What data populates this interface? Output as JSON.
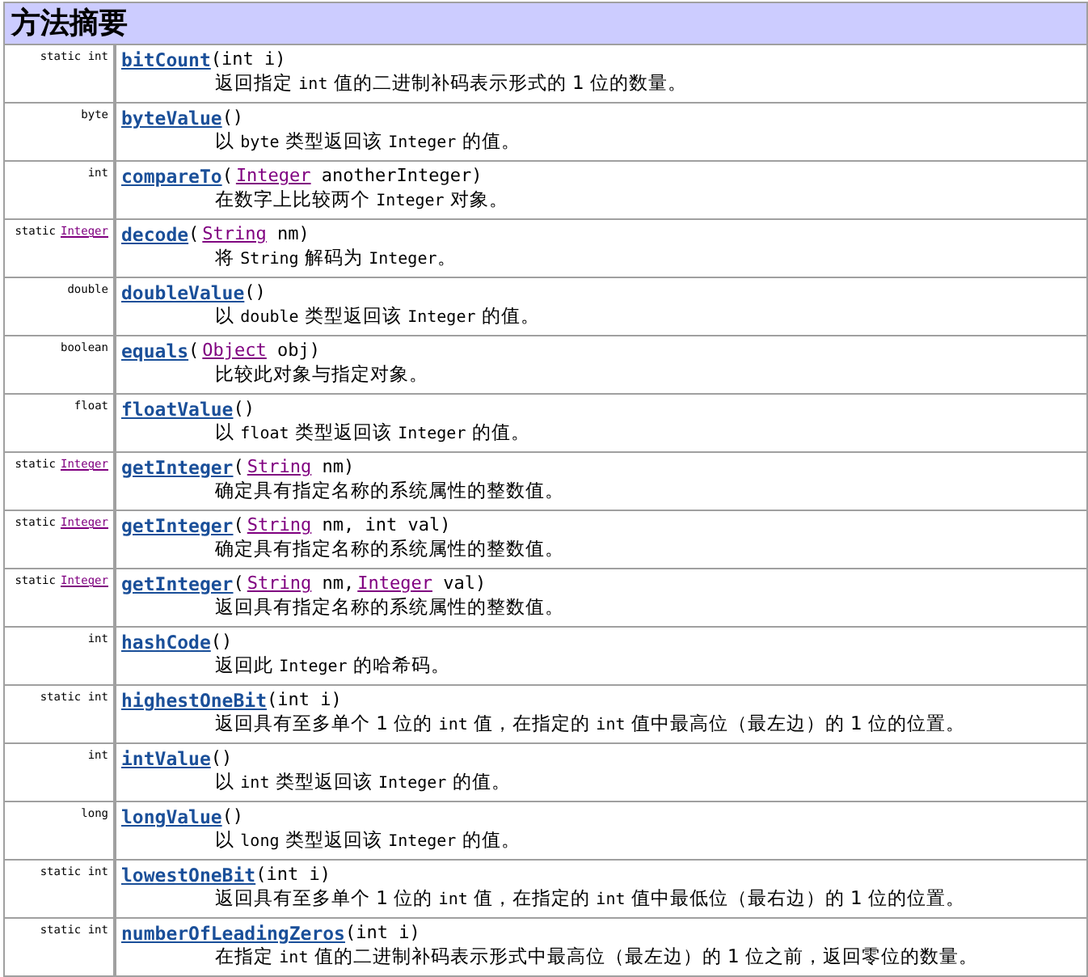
{
  "title": "方法摘要",
  "rows": [
    {
      "modifier": [
        {
          "kind": "text",
          "text": "static int"
        }
      ],
      "signature": [
        {
          "kind": "name",
          "text": "bitCount"
        },
        {
          "kind": "text",
          "text": "(int i)"
        }
      ],
      "description": [
        {
          "kind": "text",
          "text": "返回指定 "
        },
        {
          "kind": "code",
          "text": "int"
        },
        {
          "kind": "text",
          "text": " 值的二进制补码表示形式的 1 位的数量。"
        }
      ]
    },
    {
      "modifier": [
        {
          "kind": "text",
          "text": "byte"
        }
      ],
      "signature": [
        {
          "kind": "name",
          "text": "byteValue"
        },
        {
          "kind": "text",
          "text": "()"
        }
      ],
      "description": [
        {
          "kind": "text",
          "text": "以 "
        },
        {
          "kind": "code",
          "text": "byte"
        },
        {
          "kind": "text",
          "text": " 类型返回该 "
        },
        {
          "kind": "code",
          "text": "Integer"
        },
        {
          "kind": "text",
          "text": " 的值。"
        }
      ]
    },
    {
      "modifier": [
        {
          "kind": "text",
          "text": "int"
        }
      ],
      "signature": [
        {
          "kind": "name",
          "text": "compareTo"
        },
        {
          "kind": "text",
          "text": "("
        },
        {
          "kind": "type",
          "text": "Integer"
        },
        {
          "kind": "text",
          "text": " anotherInteger)"
        }
      ],
      "description": [
        {
          "kind": "text",
          "text": "在数字上比较两个 "
        },
        {
          "kind": "code",
          "text": "Integer"
        },
        {
          "kind": "text",
          "text": " 对象。"
        }
      ]
    },
    {
      "modifier": [
        {
          "kind": "text",
          "text": "static"
        },
        {
          "kind": "type",
          "text": "Integer"
        }
      ],
      "signature": [
        {
          "kind": "name",
          "text": "decode"
        },
        {
          "kind": "text",
          "text": "("
        },
        {
          "kind": "type",
          "text": "String"
        },
        {
          "kind": "text",
          "text": " nm)"
        }
      ],
      "description": [
        {
          "kind": "text",
          "text": "将 "
        },
        {
          "kind": "code",
          "text": "String"
        },
        {
          "kind": "text",
          "text": " 解码为 "
        },
        {
          "kind": "code",
          "text": "Integer"
        },
        {
          "kind": "text",
          "text": "。"
        }
      ]
    },
    {
      "modifier": [
        {
          "kind": "text",
          "text": "double"
        }
      ],
      "signature": [
        {
          "kind": "name",
          "text": "doubleValue"
        },
        {
          "kind": "text",
          "text": "()"
        }
      ],
      "description": [
        {
          "kind": "text",
          "text": "以 "
        },
        {
          "kind": "code",
          "text": "double"
        },
        {
          "kind": "text",
          "text": " 类型返回该 "
        },
        {
          "kind": "code",
          "text": "Integer"
        },
        {
          "kind": "text",
          "text": " 的值。"
        }
      ]
    },
    {
      "modifier": [
        {
          "kind": "text",
          "text": "boolean"
        }
      ],
      "signature": [
        {
          "kind": "name",
          "text": "equals"
        },
        {
          "kind": "text",
          "text": "("
        },
        {
          "kind": "type",
          "text": "Object"
        },
        {
          "kind": "text",
          "text": " obj)"
        }
      ],
      "description": [
        {
          "kind": "text",
          "text": "比较此对象与指定对象。"
        }
      ]
    },
    {
      "modifier": [
        {
          "kind": "text",
          "text": "float"
        }
      ],
      "signature": [
        {
          "kind": "name",
          "text": "floatValue"
        },
        {
          "kind": "text",
          "text": "()"
        }
      ],
      "description": [
        {
          "kind": "text",
          "text": "以 "
        },
        {
          "kind": "code",
          "text": "float"
        },
        {
          "kind": "text",
          "text": " 类型返回该 "
        },
        {
          "kind": "code",
          "text": "Integer"
        },
        {
          "kind": "text",
          "text": " 的值。"
        }
      ]
    },
    {
      "modifier": [
        {
          "kind": "text",
          "text": "static"
        },
        {
          "kind": "type",
          "text": "Integer"
        }
      ],
      "signature": [
        {
          "kind": "name",
          "text": "getInteger"
        },
        {
          "kind": "text",
          "text": "("
        },
        {
          "kind": "type",
          "text": "String"
        },
        {
          "kind": "text",
          "text": " nm)"
        }
      ],
      "description": [
        {
          "kind": "text",
          "text": "确定具有指定名称的系统属性的整数值。"
        }
      ]
    },
    {
      "modifier": [
        {
          "kind": "text",
          "text": "static"
        },
        {
          "kind": "type",
          "text": "Integer"
        }
      ],
      "signature": [
        {
          "kind": "name",
          "text": "getInteger"
        },
        {
          "kind": "text",
          "text": "("
        },
        {
          "kind": "type",
          "text": "String"
        },
        {
          "kind": "text",
          "text": " nm, int val)"
        }
      ],
      "description": [
        {
          "kind": "text",
          "text": "确定具有指定名称的系统属性的整数值。"
        }
      ]
    },
    {
      "modifier": [
        {
          "kind": "text",
          "text": "static"
        },
        {
          "kind": "type",
          "text": "Integer"
        }
      ],
      "signature": [
        {
          "kind": "name",
          "text": "getInteger"
        },
        {
          "kind": "text",
          "text": "("
        },
        {
          "kind": "type",
          "text": "String"
        },
        {
          "kind": "text",
          "text": " nm,"
        },
        {
          "kind": "type",
          "text": "Integer"
        },
        {
          "kind": "text",
          "text": " val)"
        }
      ],
      "description": [
        {
          "kind": "text",
          "text": "返回具有指定名称的系统属性的整数值。"
        }
      ]
    },
    {
      "modifier": [
        {
          "kind": "text",
          "text": "int"
        }
      ],
      "signature": [
        {
          "kind": "name",
          "text": "hashCode"
        },
        {
          "kind": "text",
          "text": "()"
        }
      ],
      "description": [
        {
          "kind": "text",
          "text": "返回此 "
        },
        {
          "kind": "code",
          "text": "Integer"
        },
        {
          "kind": "text",
          "text": " 的哈希码。"
        }
      ]
    },
    {
      "modifier": [
        {
          "kind": "text",
          "text": "static int"
        }
      ],
      "signature": [
        {
          "kind": "name",
          "text": "highestOneBit"
        },
        {
          "kind": "text",
          "text": "(int i)"
        }
      ],
      "description": [
        {
          "kind": "text",
          "text": "返回具有至多单个 1 位的 "
        },
        {
          "kind": "code",
          "text": "int"
        },
        {
          "kind": "text",
          "text": " 值，在指定的 "
        },
        {
          "kind": "code",
          "text": "int"
        },
        {
          "kind": "text",
          "text": " 值中最高位（最左边）的 1 位的位置。"
        }
      ]
    },
    {
      "modifier": [
        {
          "kind": "text",
          "text": "int"
        }
      ],
      "signature": [
        {
          "kind": "name",
          "text": "intValue"
        },
        {
          "kind": "text",
          "text": "()"
        }
      ],
      "description": [
        {
          "kind": "text",
          "text": "以 "
        },
        {
          "kind": "code",
          "text": "int"
        },
        {
          "kind": "text",
          "text": " 类型返回该 "
        },
        {
          "kind": "code",
          "text": "Integer"
        },
        {
          "kind": "text",
          "text": " 的值。"
        }
      ]
    },
    {
      "modifier": [
        {
          "kind": "text",
          "text": "long"
        }
      ],
      "signature": [
        {
          "kind": "name",
          "text": "longValue"
        },
        {
          "kind": "text",
          "text": "()"
        }
      ],
      "description": [
        {
          "kind": "text",
          "text": "以 "
        },
        {
          "kind": "code",
          "text": "long"
        },
        {
          "kind": "text",
          "text": " 类型返回该 "
        },
        {
          "kind": "code",
          "text": "Integer"
        },
        {
          "kind": "text",
          "text": " 的值。"
        }
      ]
    },
    {
      "modifier": [
        {
          "kind": "text",
          "text": "static int"
        }
      ],
      "signature": [
        {
          "kind": "name",
          "text": "lowestOneBit"
        },
        {
          "kind": "text",
          "text": "(int i)"
        }
      ],
      "description": [
        {
          "kind": "text",
          "text": "返回具有至多单个 1 位的 "
        },
        {
          "kind": "code",
          "text": "int"
        },
        {
          "kind": "text",
          "text": " 值，在指定的 "
        },
        {
          "kind": "code",
          "text": "int"
        },
        {
          "kind": "text",
          "text": " 值中最低位（最右边）的 1 位的位置。"
        }
      ]
    },
    {
      "modifier": [
        {
          "kind": "text",
          "text": "static int"
        }
      ],
      "signature": [
        {
          "kind": "name",
          "text": "numberOfLeadingZeros"
        },
        {
          "kind": "text",
          "text": "(int i)"
        }
      ],
      "description": [
        {
          "kind": "text",
          "text": "在指定 "
        },
        {
          "kind": "code",
          "text": "int"
        },
        {
          "kind": "text",
          "text": " 值的二进制补码表示形式中最高位（最左边）的 1 位之前，返回零位的数量。"
        }
      ]
    }
  ]
}
